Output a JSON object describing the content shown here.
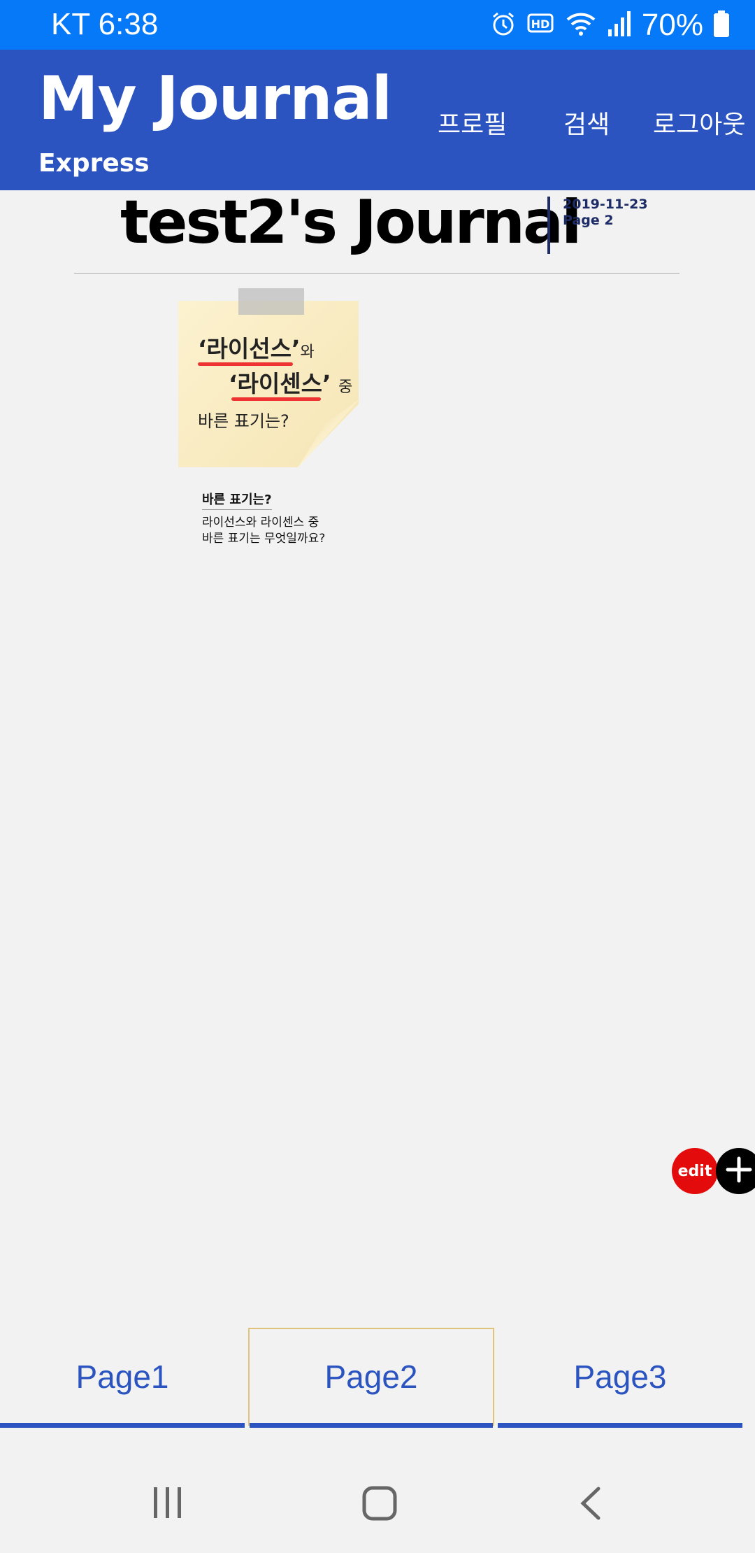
{
  "status_bar": {
    "carrier_time": "KT 6:38",
    "battery_percent": "70%",
    "icons": [
      "alarm-icon",
      "hd-icon",
      "wifi-icon",
      "signal-icon",
      "battery-icon"
    ]
  },
  "app_header": {
    "title": "My Journal",
    "subtitle": "Express",
    "nav": {
      "profile": "프로필",
      "search": "검색",
      "logout": "로그아웃"
    }
  },
  "journal": {
    "title": "test2's Journal",
    "date": "2019-11-23",
    "page": "Page 2"
  },
  "card": {
    "sticky_note": {
      "line1_quote": "‘라이선스’",
      "line1_suffix": "와",
      "line2_quote": "‘라이센스’",
      "line2_suffix": "중",
      "line3": "바른 표기는?"
    },
    "caption_title": "바른 표기는?",
    "caption_body_line1": "라이선스와 라이센스 중",
    "caption_body_line2": "바른 표기는 무엇일까요?"
  },
  "fabs": {
    "edit_label": "edit"
  },
  "page_tabs": [
    {
      "label": "Page1"
    },
    {
      "label": "Page2"
    },
    {
      "label": "Page3"
    }
  ],
  "active_tab": "Page2",
  "colors": {
    "status_bar": "#0579f8",
    "header": "#2b54c0",
    "edit_button": "#e30b0b",
    "tab_text": "#2b54c0"
  }
}
